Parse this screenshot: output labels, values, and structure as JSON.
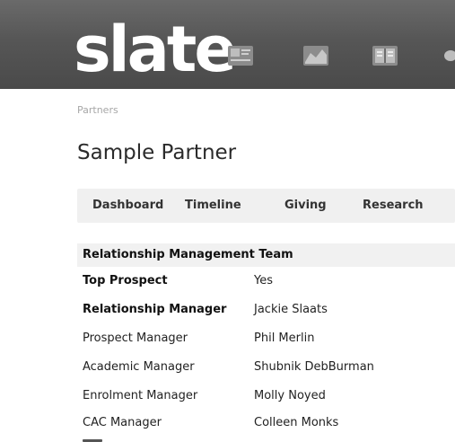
{
  "header": {
    "logo_text": "slate",
    "nav_icons": [
      "people-icon",
      "chart-icon",
      "book-icon",
      "partial-icon"
    ],
    "background_color": "#555555"
  },
  "breadcrumb": {
    "text": "Partners"
  },
  "page": {
    "title": "Sample Partner"
  },
  "tabs": [
    {
      "label": "Dashboard"
    },
    {
      "label": "Timeline"
    },
    {
      "label": "Giving"
    },
    {
      "label": "Research"
    }
  ],
  "section": {
    "title": "Relationship Management Team",
    "rows": [
      {
        "label": "Top Prospect",
        "value": "Yes",
        "bold": true
      },
      {
        "label": "Relationship Manager",
        "value": "Jackie Slaats",
        "bold": true
      },
      {
        "label": "Prospect Manager",
        "value": "Phil Merlin",
        "bold": false
      },
      {
        "label": "Academic Manager",
        "value": "Shubnik DebBurman",
        "bold": false
      },
      {
        "label": "Enrolment Manager",
        "value": "Molly Noyed",
        "bold": false
      },
      {
        "label": "CAC Manager",
        "value": "Colleen Monks",
        "bold": false
      }
    ]
  }
}
